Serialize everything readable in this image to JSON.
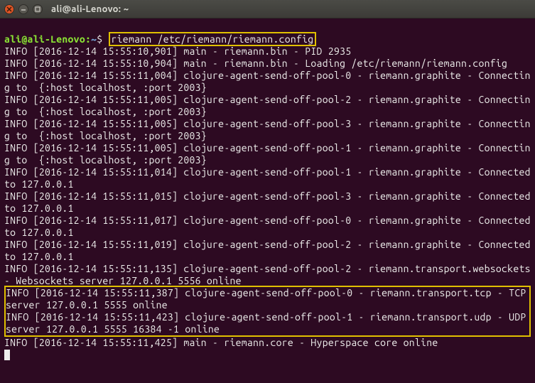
{
  "window": {
    "title": "ali@ali-Lenovo: ~"
  },
  "prompt": {
    "user_host": "ali@ali-Lenovo:",
    "cwd": "~",
    "symbol": "$"
  },
  "command": "riemann /etc/riemann/riemann.config",
  "lines": {
    "l0": "INFO [2016-12-14 15:55:10,901] main - riemann.bin - PID 2935",
    "l1": "INFO [2016-12-14 15:55:10,904] main - riemann.bin - Loading /etc/riemann/riemann.config",
    "l2": "INFO [2016-12-14 15:55:11,004] clojure-agent-send-off-pool-0 - riemann.graphite - Connecting to  {:host localhost, :port 2003}",
    "l3": "INFO [2016-12-14 15:55:11,005] clojure-agent-send-off-pool-2 - riemann.graphite - Connecting to  {:host localhost, :port 2003}",
    "l4": "INFO [2016-12-14 15:55:11,005] clojure-agent-send-off-pool-3 - riemann.graphite - Connecting to  {:host localhost, :port 2003}",
    "l5": "INFO [2016-12-14 15:55:11,005] clojure-agent-send-off-pool-1 - riemann.graphite - Connecting to  {:host localhost, :port 2003}",
    "l6": "INFO [2016-12-14 15:55:11,014] clojure-agent-send-off-pool-1 - riemann.graphite - Connected to 127.0.0.1",
    "l7": "INFO [2016-12-14 15:55:11,015] clojure-agent-send-off-pool-3 - riemann.graphite - Connected to 127.0.0.1",
    "l8": "INFO [2016-12-14 15:55:11,017] clojure-agent-send-off-pool-0 - riemann.graphite - Connected to 127.0.0.1",
    "l9": "INFO [2016-12-14 15:55:11,019] clojure-agent-send-off-pool-2 - riemann.graphite - Connected to 127.0.0.1",
    "l10": "INFO [2016-12-14 15:55:11,135] clojure-agent-send-off-pool-2 - riemann.transport.websockets - Websockets server 127.0.0.1 5556 online",
    "l11": "INFO [2016-12-14 15:55:11,387] clojure-agent-send-off-pool-0 - riemann.transport.tcp - TCP server 127.0.0.1 5555 online",
    "l12": "INFO [2016-12-14 15:55:11,423] clojure-agent-send-off-pool-1 - riemann.transport.udp - UDP server 127.0.0.1 5555 16384 -1 online",
    "l13": "INFO [2016-12-14 15:55:11,425] main - riemann.core - Hyperspace core online"
  },
  "icons": {
    "close": "close-icon",
    "min": "minimize-icon",
    "max": "maximize-icon"
  }
}
